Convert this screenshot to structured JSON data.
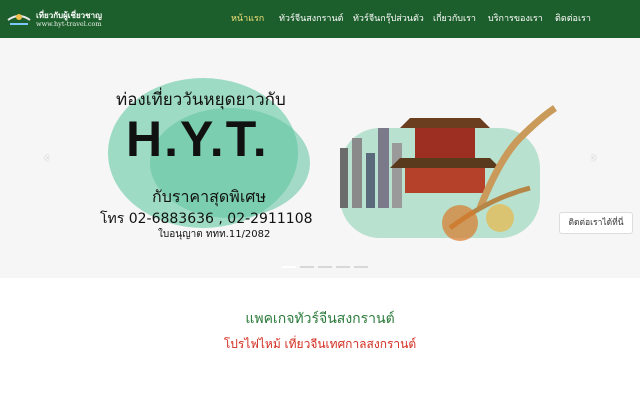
{
  "brand": {
    "title": "เที่ยวกับผู้เชี่ยวชาญ",
    "url": "www.hyt-travel.com"
  },
  "nav": {
    "items": [
      {
        "label": "หน้าแรก",
        "active": true
      },
      {
        "label": "ทัวร์จีนสงกรานต์",
        "active": false
      },
      {
        "label": "ทัวร์จีนกรุ๊ปส่วนตัว",
        "active": false
      },
      {
        "label": "เกี่ยวกับเรา",
        "active": false
      },
      {
        "label": "บริการของเรา",
        "active": false
      },
      {
        "label": "ติดต่อเรา",
        "active": false
      }
    ]
  },
  "banner": {
    "headline": "ท่องเที่ยววันหยุดยาวกับ",
    "brand": "H.Y.T.",
    "subline": "กับราคาสุดพิเศษ",
    "phone": "โทร 02-6883636 , 02-2911108",
    "license": "ใบอนุญาต ททท.11/2082",
    "contact_button": "ติดต่อเราได้ที่นี่",
    "prev_icon": "chevron-left-icon",
    "next_icon": "chevron-right-icon",
    "slide_count": 5,
    "active_slide": 0
  },
  "section": {
    "title": "แพคเกจทัวร์จีนสงกรานต์",
    "subtitle": "โปรไฟไหม้ เที่ยวจีนเทศกาลสงกรานต์"
  },
  "colors": {
    "topbar": "#1d5f2c",
    "nav_active": "#f4e27a",
    "section_title": "#2a7a3a",
    "section_sub": "#d32d1f",
    "splash": "#5fc2a0"
  }
}
